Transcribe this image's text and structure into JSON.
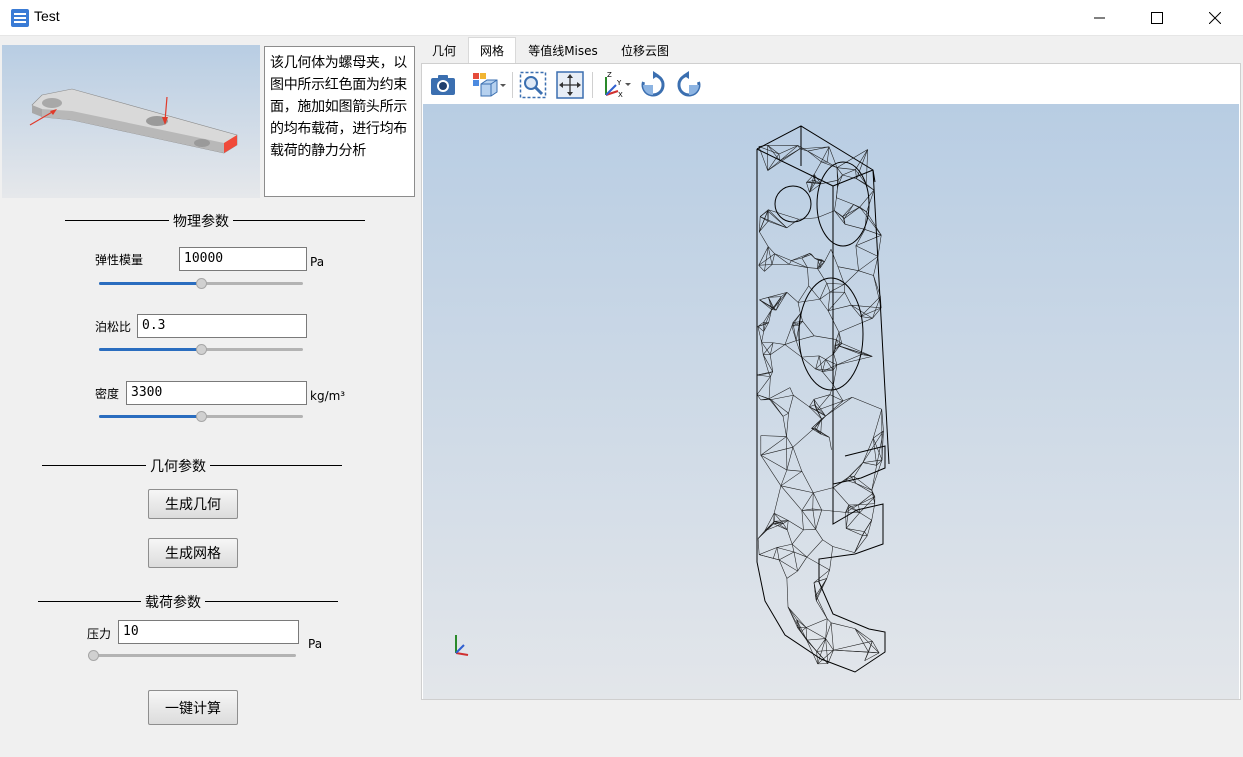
{
  "window": {
    "title": "Test"
  },
  "description": "该几何体为螺母夹，以图中所示红色面为约束面，施加如图箭头所示的均布载荷，进行均布载荷的静力分析",
  "physical": {
    "group_title": "物理参数",
    "youngs": {
      "label": "弹性模量",
      "value": "10000",
      "unit": "Pa",
      "slider_fraction": 0.5
    },
    "poisson": {
      "label": "泊松比",
      "value": "0.3",
      "slider_fraction": 0.5
    },
    "density": {
      "label": "密度",
      "value": "3300",
      "unit": "kg/m³",
      "slider_fraction": 0.5
    }
  },
  "geometry": {
    "group_title": "几何参数",
    "gen_geometry_label": "生成几何",
    "gen_mesh_label": "生成网格"
  },
  "load": {
    "group_title": "载荷参数",
    "pressure": {
      "label": "压力",
      "value": "10",
      "unit": "Pa",
      "slider_fraction": 0.0
    },
    "compute_label": "一键计算"
  },
  "tabs": [
    {
      "label": "几何",
      "active": false
    },
    {
      "label": "网格",
      "active": true
    },
    {
      "label": "等值线Mises",
      "active": false
    },
    {
      "label": "位移云图",
      "active": false
    }
  ],
  "toolbar": {
    "icons": [
      "camera-icon",
      "view-cube-icon",
      "zoom-fit-icon",
      "pan-icon",
      "axes-orientation-icon",
      "rotate-cw-icon",
      "rotate-ccw-icon"
    ]
  },
  "colors": {
    "accent": "#2a6dbf",
    "constraint_face": "#f04a3a",
    "viewport_top": "#b8cde3",
    "viewport_bottom": "#e3e6ea"
  }
}
